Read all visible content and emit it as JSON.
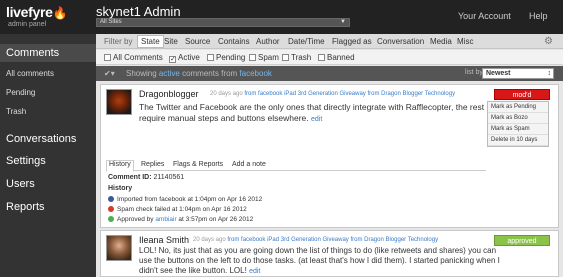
{
  "header": {
    "logo": "livefyre",
    "logo_sub": "admin panel",
    "title": "skynet1 Admin",
    "site_select": "All Sites",
    "account_link": "Your Account",
    "help_link": "Help"
  },
  "sidebar": {
    "items": [
      {
        "label": "Comments",
        "kind": "main",
        "active": true
      },
      {
        "label": "All comments",
        "kind": "sub"
      },
      {
        "label": "Pending",
        "kind": "sub"
      },
      {
        "label": "Trash",
        "kind": "sub"
      },
      {
        "label": "Conversations",
        "kind": "main"
      },
      {
        "label": "Settings",
        "kind": "main"
      },
      {
        "label": "Users",
        "kind": "main"
      },
      {
        "label": "Reports",
        "kind": "main"
      }
    ]
  },
  "filter": {
    "label": "Filter by",
    "tabs": [
      "State",
      "Site",
      "Source",
      "Contains",
      "Author",
      "Date/Time",
      "Flagged as",
      "Conversation",
      "Media",
      "Misc"
    ]
  },
  "states": [
    {
      "label": "All Comments",
      "checked": false
    },
    {
      "label": "Active",
      "checked": true
    },
    {
      "label": "Pending",
      "checked": false
    },
    {
      "label": "Spam",
      "checked": false
    },
    {
      "label": "Trash",
      "checked": false
    },
    {
      "label": "Banned",
      "checked": false
    }
  ],
  "showing": {
    "prefix": "Showing",
    "state": "active",
    "middle": "comments from",
    "source": "facebook",
    "list_by_label": "list by",
    "sort_value": "Newest"
  },
  "comments": [
    {
      "author": "Dragonblogger",
      "time": "20 days ago",
      "source_link": "from facebook",
      "conversation": "iPad 3rd Generation Giveaway from Dragon Blogger Technology",
      "body": "The Twitter and Facebook are the only ones that directly integrate with Rafflecopter, the rest require manual steps and buttons elsewhere.",
      "edit": "edit",
      "status": "mod'd",
      "actions": [
        "Mark as Pending",
        "Mark as Bozo",
        "Mark as Spam",
        "Delete in 10 days"
      ],
      "tabs": [
        "History",
        "Replies",
        "Flags & Reports",
        "Add a note"
      ],
      "comment_id_label": "Comment ID:",
      "comment_id": "21140561",
      "history_label": "History",
      "history": [
        {
          "pre": "Imported from facebook at 1:04pm on Apr 16 2012",
          "link": "",
          "post": ""
        },
        {
          "pre": "Spam check failed at 1:04pm on Apr 16 2012",
          "link": "",
          "post": ""
        },
        {
          "pre": "Approved by ",
          "link": "ambiair",
          "post": " at 3:57pm on Apr 26 2012"
        }
      ]
    },
    {
      "author": "Ileana Smith",
      "time": "20 days ago",
      "source_link": "from facebook",
      "conversation": "iPad 3rd Generation Giveaway from Dragon Blogger Technology",
      "body": "LOL! No, its just that as you are going down the list of things to do (like retweets and shares) you can use the buttons on the left to do those tasks. (at least that's how I did them). I started panicking when I didn't see the like button. LOL!",
      "edit": "edit",
      "status": "approved"
    }
  ],
  "colors": {
    "topbar": "#222222",
    "sidebar": "#333333",
    "accent_link": "#3a7bc8",
    "status_mod": "#d81818",
    "status_approved": "#8bc34a"
  },
  "icons": {
    "gear": "gear-icon",
    "collapse": "collapse-icon",
    "facebook": "facebook-icon",
    "spam": "spam-icon",
    "approved": "check-icon"
  }
}
